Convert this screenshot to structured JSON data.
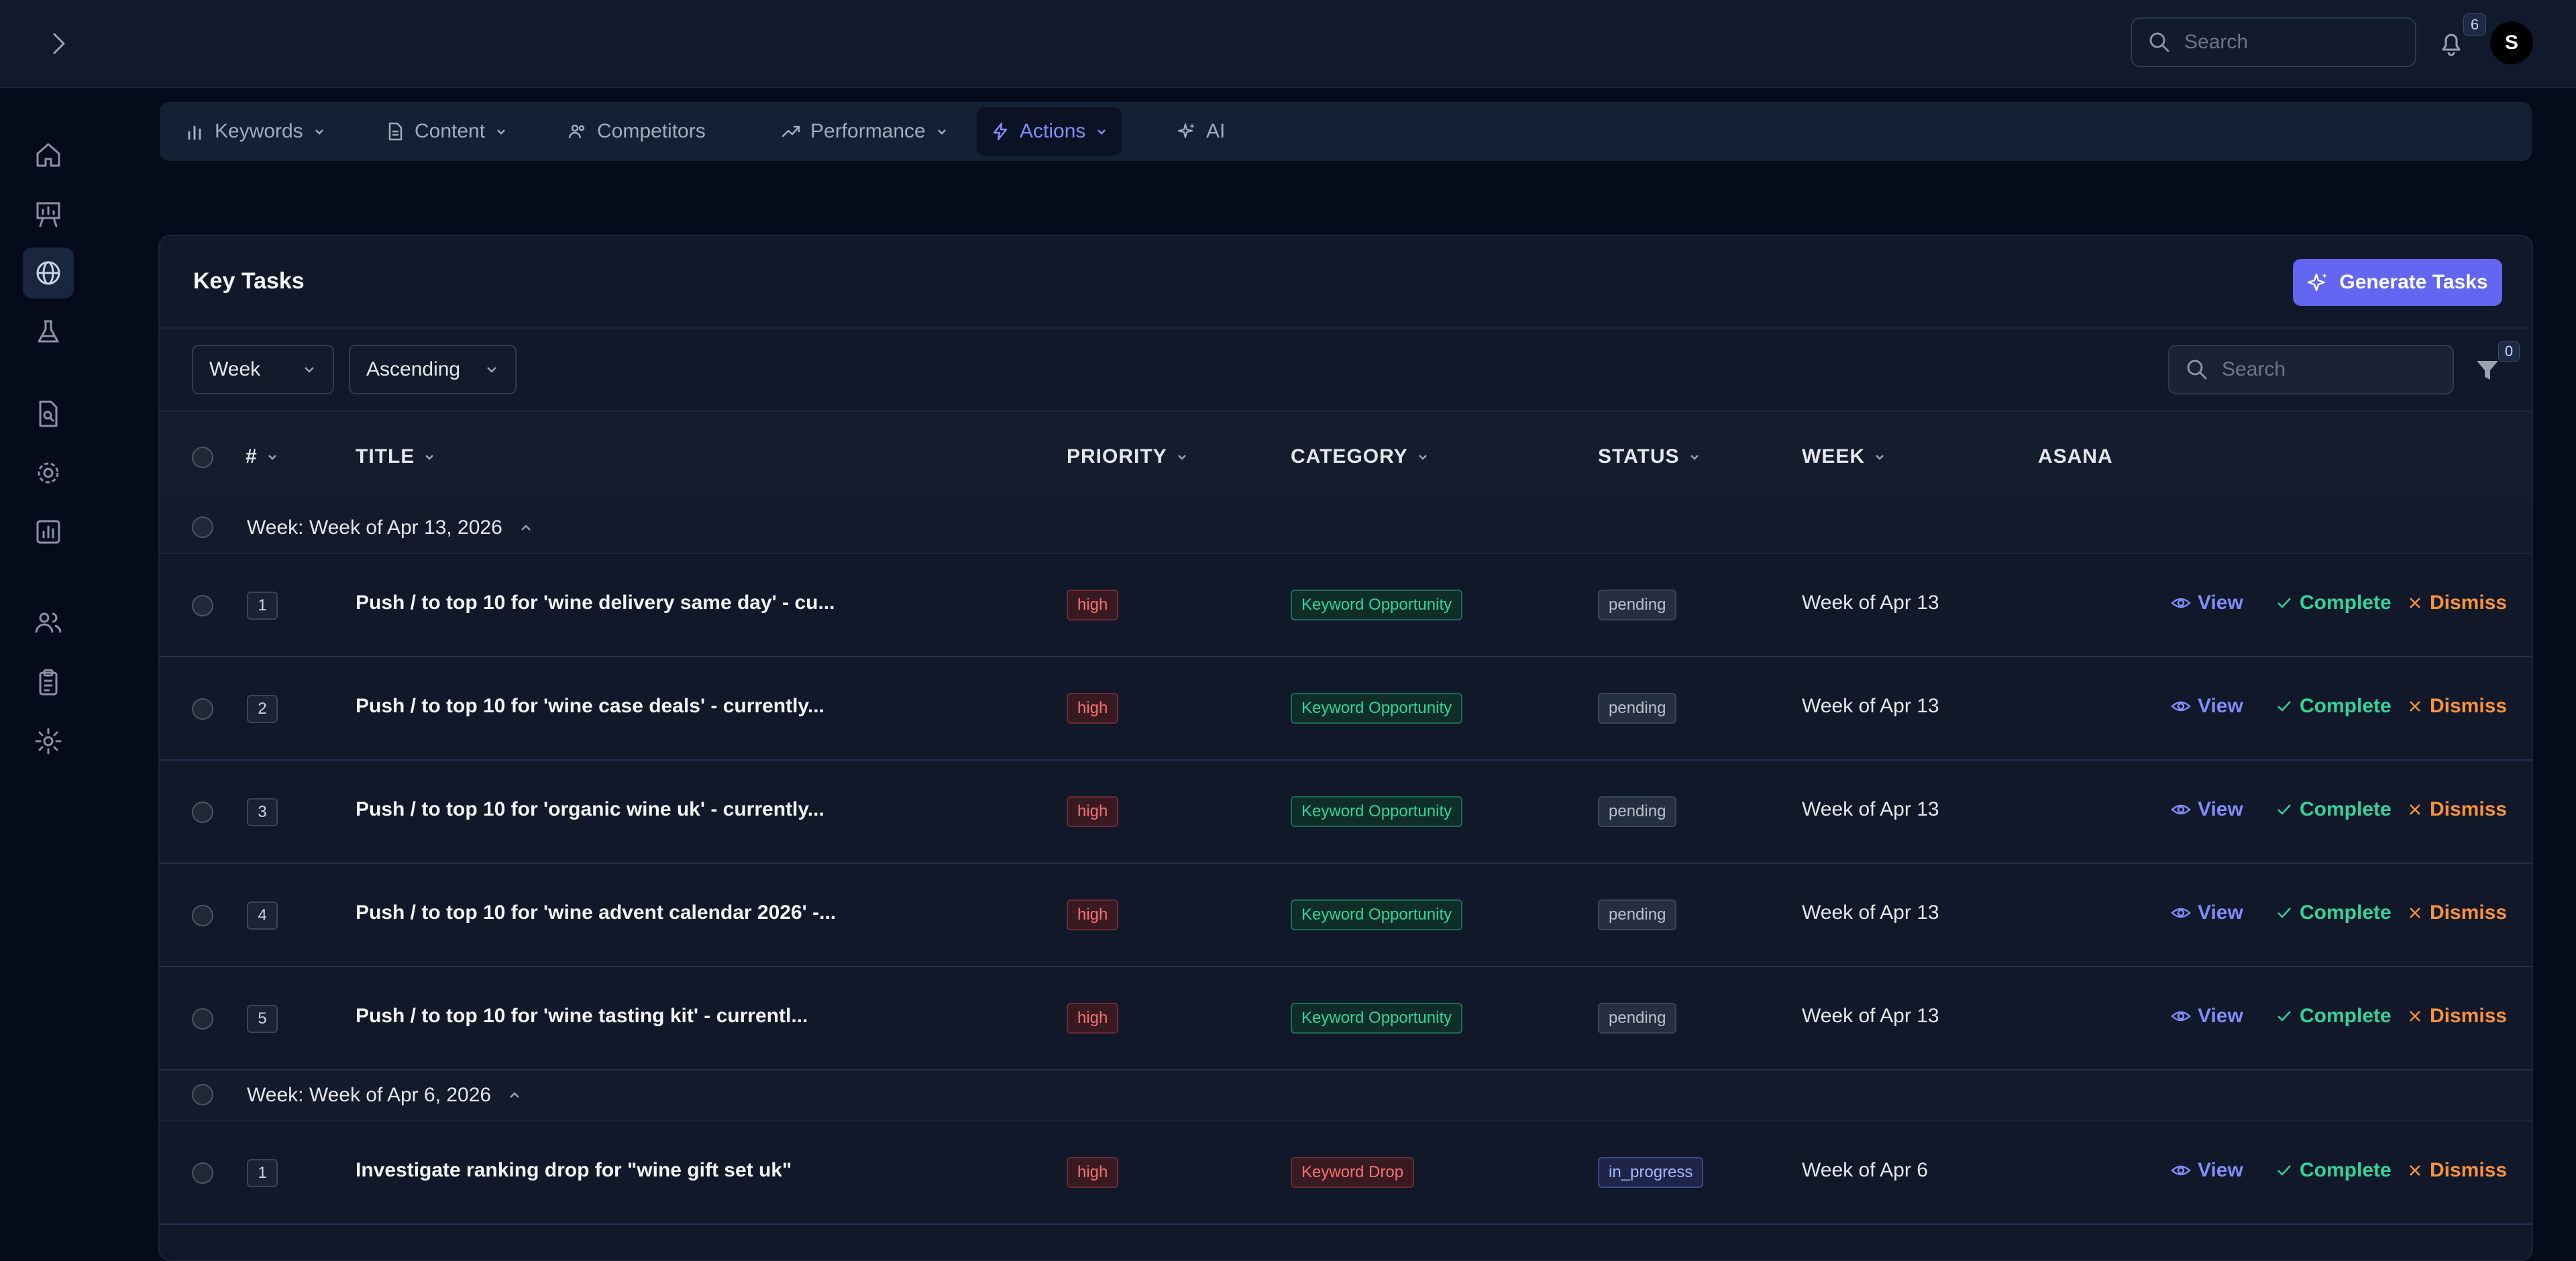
{
  "header": {
    "search_placeholder": "Search",
    "notifications_count": "6",
    "avatar_initial": "S"
  },
  "sidebar": {
    "icons": [
      "home-icon",
      "presentation-icon",
      "globe-icon",
      "flask-icon",
      "file-search-icon",
      "settings-icon",
      "bar-chart-icon",
      "users-icon",
      "clipboard-icon",
      "cog-icon"
    ],
    "active": "globe-icon"
  },
  "nav": {
    "tabs": [
      {
        "label": "Keywords",
        "icon": "bar-chart-icon",
        "dropdown": true
      },
      {
        "label": "Content",
        "icon": "file-icon",
        "dropdown": true
      },
      {
        "label": "Competitors",
        "icon": "users-icon",
        "dropdown": false
      },
      {
        "label": "Performance",
        "icon": "trending-up-icon",
        "dropdown": true
      },
      {
        "label": "Actions",
        "icon": "zap-icon",
        "dropdown": true,
        "active": true
      },
      {
        "label": "AI",
        "icon": "sparkles-icon",
        "dropdown": false
      }
    ]
  },
  "card": {
    "title": "Key Tasks",
    "generate_label": "Generate Tasks",
    "group_select": "Week",
    "sort_select": "Ascending",
    "search_placeholder": "Search",
    "filter_count": "0"
  },
  "table": {
    "columns": {
      "num": "#",
      "title": "TITLE",
      "priority": "PRIORITY",
      "category": "CATEGORY",
      "status": "STATUS",
      "week": "WEEK",
      "asana": "ASANA"
    },
    "actions": {
      "view": "View",
      "complete": "Complete",
      "dismiss": "Dismiss"
    },
    "groups": [
      {
        "label": "Week: Week of Apr 13, 2026",
        "rows": [
          {
            "num": "1",
            "title": "Push / to top 10 for 'wine delivery same day' - cu...",
            "priority": "high",
            "category": "Keyword Opportunity",
            "status": "pending",
            "week": "Week of Apr 13"
          },
          {
            "num": "2",
            "title": "Push / to top 10 for 'wine case deals' - currently...",
            "priority": "high",
            "category": "Keyword Opportunity",
            "status": "pending",
            "week": "Week of Apr 13"
          },
          {
            "num": "3",
            "title": "Push / to top 10 for 'organic wine uk' - currently...",
            "priority": "high",
            "category": "Keyword Opportunity",
            "status": "pending",
            "week": "Week of Apr 13"
          },
          {
            "num": "4",
            "title": "Push / to top 10 for 'wine advent calendar 2026' -...",
            "priority": "high",
            "category": "Keyword Opportunity",
            "status": "pending",
            "week": "Week of Apr 13"
          },
          {
            "num": "5",
            "title": "Push / to top 10 for 'wine tasting kit' - currentl...",
            "priority": "high",
            "category": "Keyword Opportunity",
            "status": "pending",
            "week": "Week of Apr 13"
          }
        ]
      },
      {
        "label": "Week: Week of Apr 6, 2026",
        "rows": [
          {
            "num": "1",
            "title": "Investigate ranking drop for \"wine gift set uk\"",
            "priority": "high",
            "category": "Keyword Drop",
            "status": "in_progress",
            "week": "Week of Apr 6"
          }
        ]
      }
    ]
  }
}
